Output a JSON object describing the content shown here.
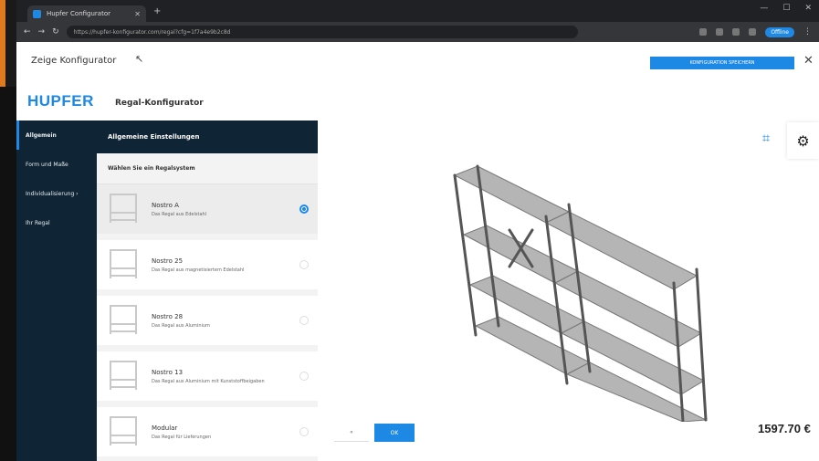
{
  "browser": {
    "tab_title": "Hupfer Configurator",
    "url": "https://hupfer-konfigurator.com/regal?cfg=1f7a4e9b2c8d",
    "profile_label": "Offline"
  },
  "topbar": {
    "title": "Zeige Konfigurator",
    "primary_button_label": "KONFIGURATION SPEICHERN"
  },
  "brand": {
    "logo": "HUPFER",
    "subtitle": "Regal-Konfigurator"
  },
  "sidebar": {
    "items": [
      {
        "label": "Allgemein"
      },
      {
        "label": "Form und Maße"
      },
      {
        "label": "Individualisierung ›"
      },
      {
        "label": "Ihr Regal"
      }
    ]
  },
  "options": {
    "header": "Allgemeine Einstellungen",
    "subheader": "Wählen Sie ein Regalsystem",
    "items": [
      {
        "title": "Nostro A",
        "desc": "Das Regal aus Edelstahl",
        "selected": true
      },
      {
        "title": "Nostro 25",
        "desc": "Das Regal aus magnetisiertem Edelstahl",
        "selected": false
      },
      {
        "title": "Nostro 28",
        "desc": "Das Regal aus Aluminium",
        "selected": false
      },
      {
        "title": "Nostro 13",
        "desc": "Das Regal aus Aluminium mit Kunststoffbeigaben",
        "selected": false
      },
      {
        "title": "Modular",
        "desc": "Das Regal für Lieferungen",
        "selected": false
      }
    ]
  },
  "viewer": {
    "back_label": "«",
    "ok_label": "OK",
    "price": "1597.70 €"
  },
  "colors": {
    "accent": "#1e88e5",
    "navy": "#0f2434"
  }
}
